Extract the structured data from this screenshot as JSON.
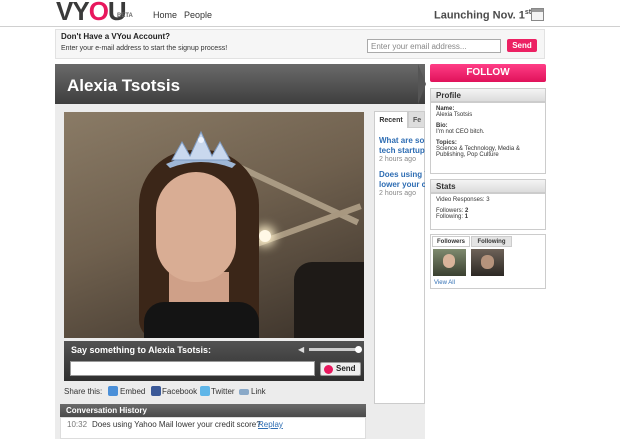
{
  "header": {
    "logo": "VYOU",
    "beta": "BETA",
    "nav": [
      "Home",
      "People"
    ],
    "launch": "Launching Nov. 1",
    "launch_suffix": "st"
  },
  "signup": {
    "question": "Don't Have a VYou Account?",
    "hint": "Enter your e-mail address to start the signup process!",
    "email_placeholder": "Enter your email address...",
    "send_label": "Send"
  },
  "profile_header": {
    "name": "Alexia Tsotsis"
  },
  "video": {
    "say_label": "Say something to Alexia Tsotsis:",
    "send_label": "Send",
    "volume_level": 1.0
  },
  "share": {
    "label": "Share this:",
    "items": [
      "Embed",
      "Facebook",
      "Twitter",
      "Link"
    ]
  },
  "conversation": {
    "title": "Conversation History",
    "rows": [
      {
        "time": "10:32",
        "question": "Does using Yahoo Mail lower your credit score?",
        "action": "Replay"
      }
    ]
  },
  "recent": {
    "tabs": [
      "Recent",
      "Fe"
    ],
    "items": [
      {
        "lines": [
          "What are son",
          "tech startups"
        ],
        "time": "2 hours ago"
      },
      {
        "lines": [
          "Does using Y",
          "lower your c"
        ],
        "time": "2 hours ago"
      }
    ]
  },
  "sidebar": {
    "follow_label": "FOLLOW",
    "profile": {
      "title": "Profile",
      "name_label": "Name:",
      "name_value": "Alexia Tsotsis",
      "bio_label": "Bio:",
      "bio_value": "I'm not CEO bitch.",
      "topics_label": "Topics:",
      "topics_value_1": "Science & Technology, Media &",
      "topics_value_2": "Publishing, Pop Culture"
    },
    "stats": {
      "title": "Stats",
      "video_responses": "Video Responses: 3",
      "followers_label": "Followers: ",
      "followers_value": "2",
      "following_label": "Following: ",
      "following_value": "1"
    },
    "followers_tabs": [
      "Followers",
      "Following"
    ],
    "view_all": "View All"
  },
  "colors": {
    "accent": "#ec2163",
    "link": "#2e6db3",
    "header_dark": "#4a4a4a"
  }
}
